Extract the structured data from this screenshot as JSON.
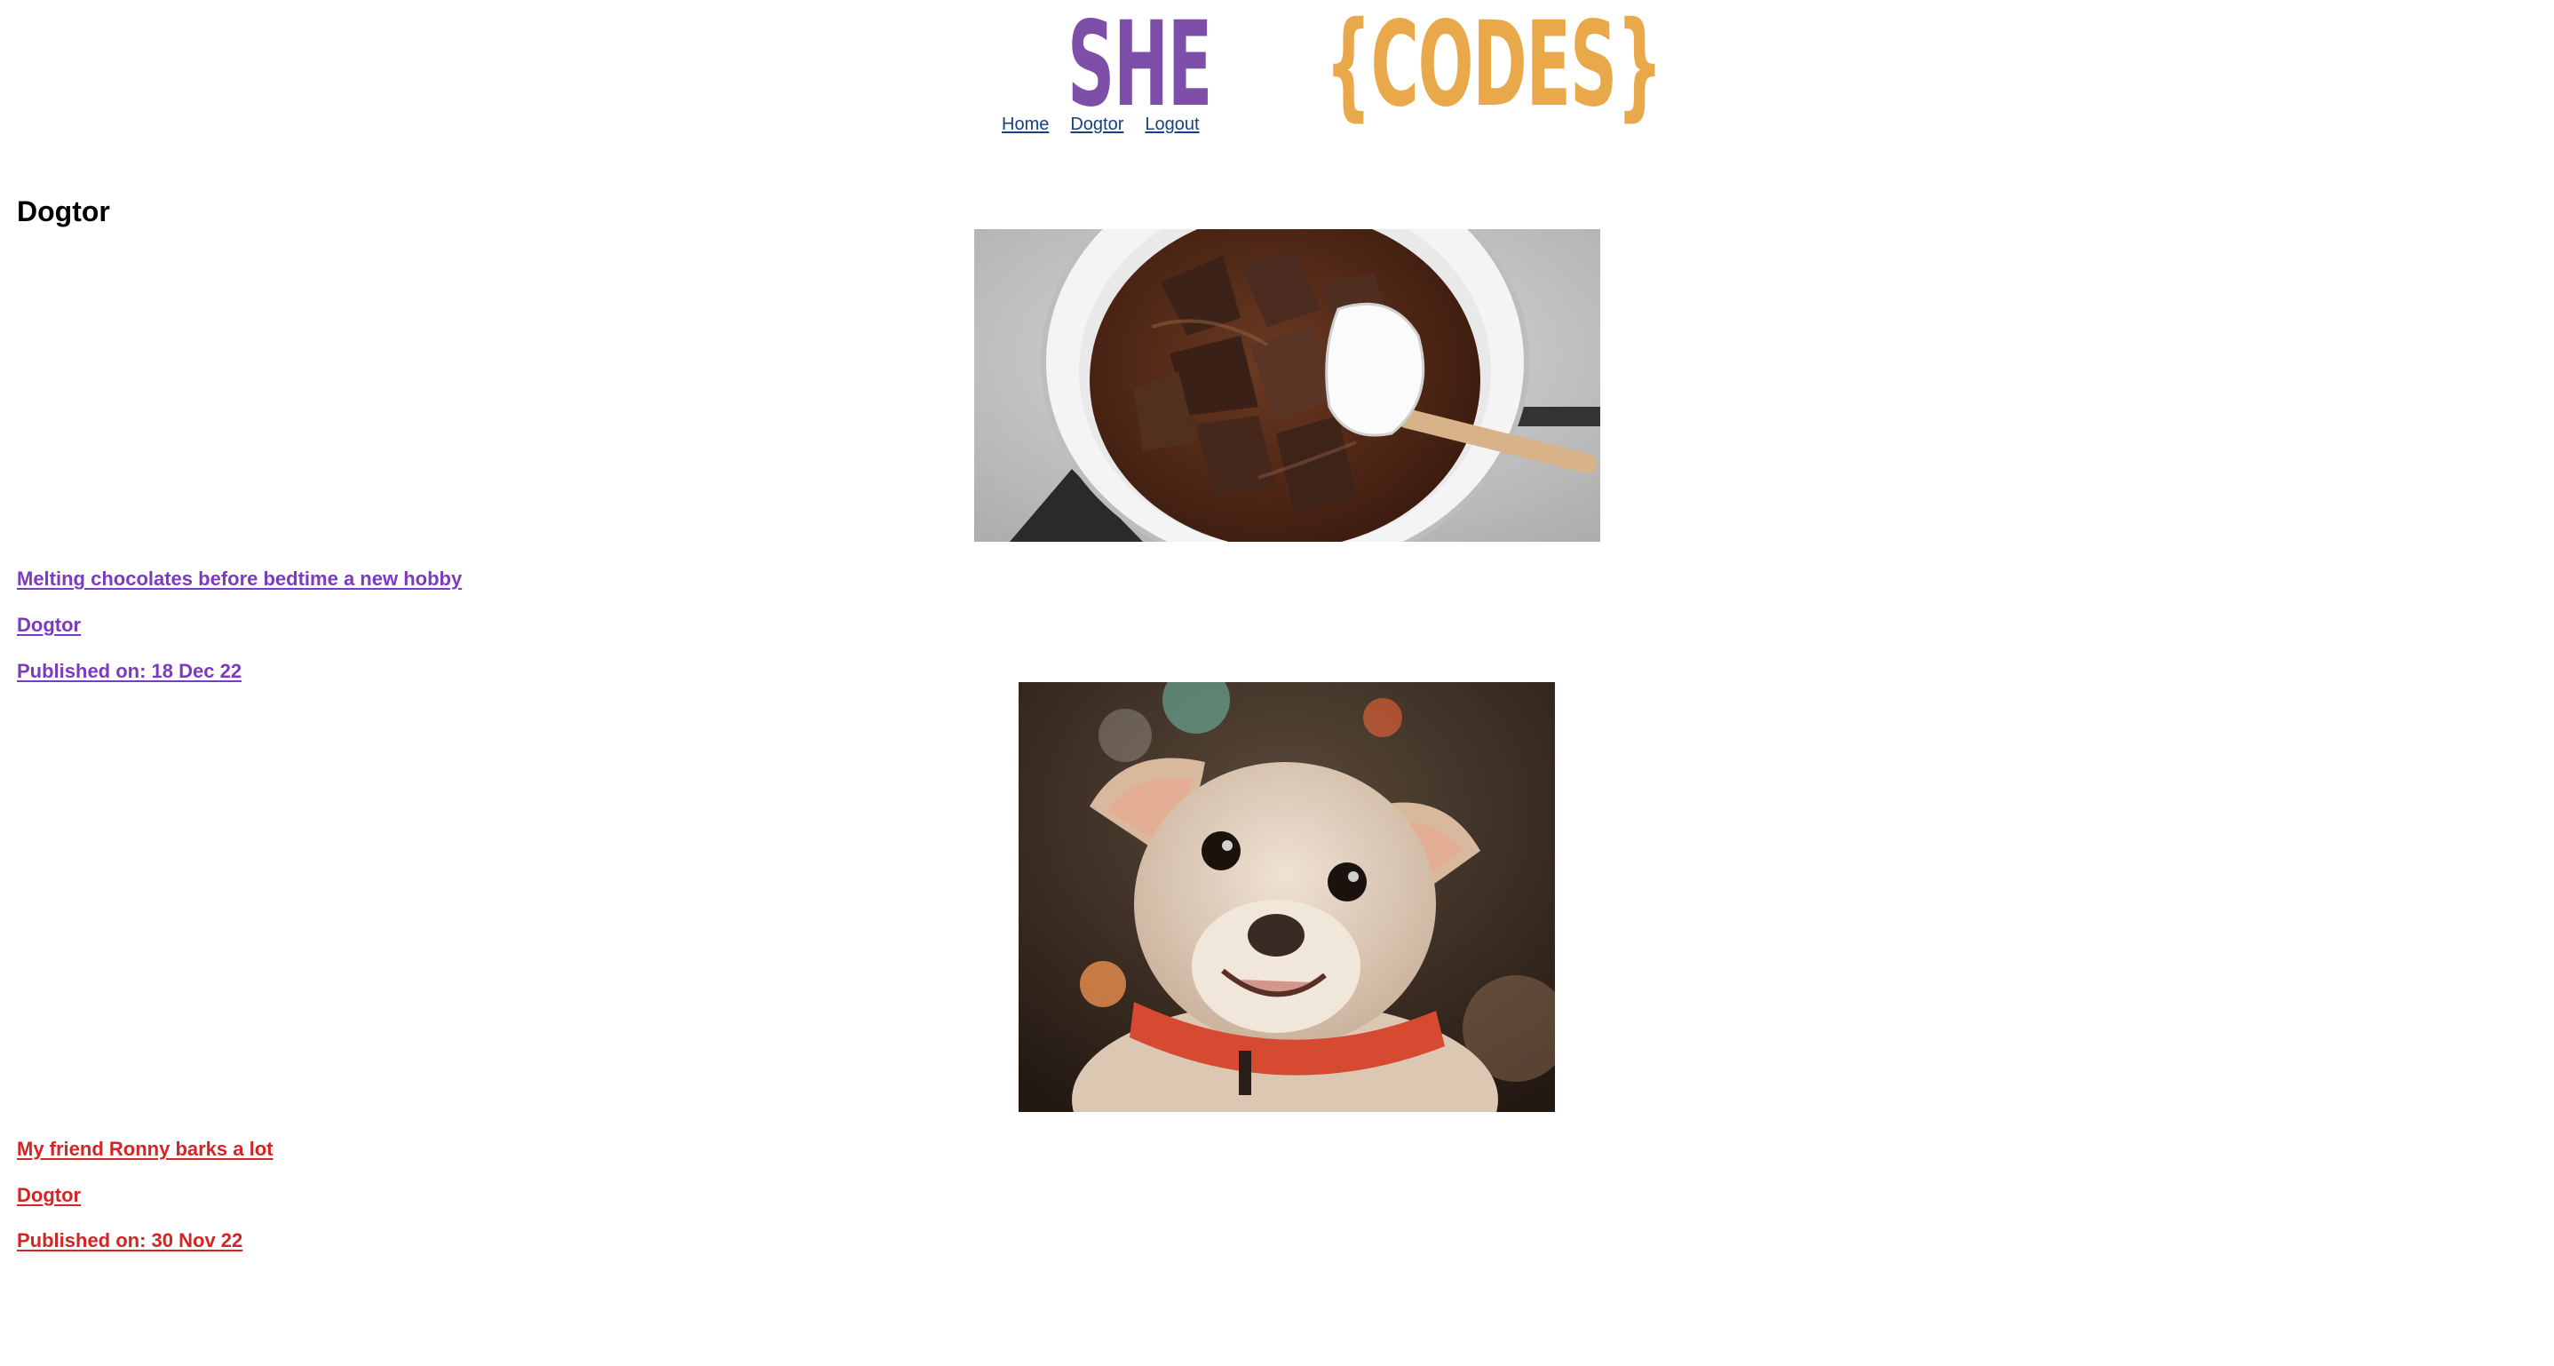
{
  "logo": {
    "part1": "SHE",
    "part2": "{CODES}"
  },
  "nav": {
    "items": [
      {
        "label": "Home"
      },
      {
        "label": "Dogtor"
      },
      {
        "label": "Logout"
      }
    ]
  },
  "page": {
    "title": "Dogtor"
  },
  "posts": [
    {
      "title": "Melting chocolates before bedtime a new hobby",
      "author": "Dogtor",
      "published": "Published on: 18 Dec 22",
      "image": "melting-chocolate-photo",
      "color": "#7c3bbf"
    },
    {
      "title": "My friend Ronny barks a lot",
      "author": "Dogtor",
      "published": "Published on: 30 Nov 22",
      "image": "smiling-dog-photo",
      "color": "#d42525"
    }
  ],
  "colors": {
    "logo_purple": "#7e4fa8",
    "logo_orange": "#e9a94a",
    "nav_link": "#17427f"
  }
}
